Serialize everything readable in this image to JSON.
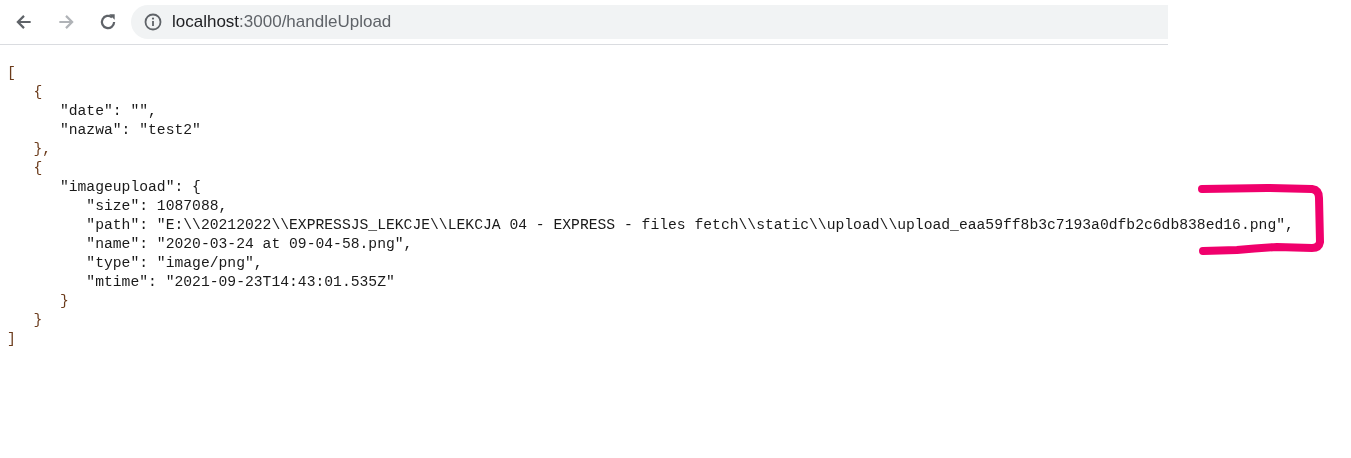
{
  "browser": {
    "back": {
      "disabled": false
    },
    "forward": {
      "disabled": true
    },
    "address": {
      "host": "localhost",
      "rest": ":3000/handleUpload"
    }
  },
  "json_view": {
    "open": "[",
    "close": "]",
    "children": [
      {
        "open": "{",
        "close": "},",
        "children": [
          {
            "text": "\"date\": \"\","
          },
          {
            "text": "\"nazwa\": \"test2\""
          }
        ]
      },
      {
        "open": "{",
        "close": "}",
        "children": [
          {
            "open": "\"imageupload\": {",
            "close": "}",
            "children": [
              {
                "text": "\"size\": 1087088,"
              },
              {
                "text": "\"path\": \"E:\\\\20212022\\\\EXPRESSJS_LEKCJE\\\\LEKCJA 04 - EXPRESS - files fetch\\\\static\\\\upload\\\\upload_eaa59ff8b3c7193a0dfb2c6db838ed16.png\","
              },
              {
                "text": "\"name\": \"2020-03-24 at 09-04-58.png\","
              },
              {
                "text": "\"type\": \"image/png\","
              },
              {
                "text": "\"mtime\": \"2021-09-23T14:43:01.535Z\""
              }
            ]
          }
        ]
      }
    ]
  },
  "annotation": {
    "kind": "bracket"
  }
}
